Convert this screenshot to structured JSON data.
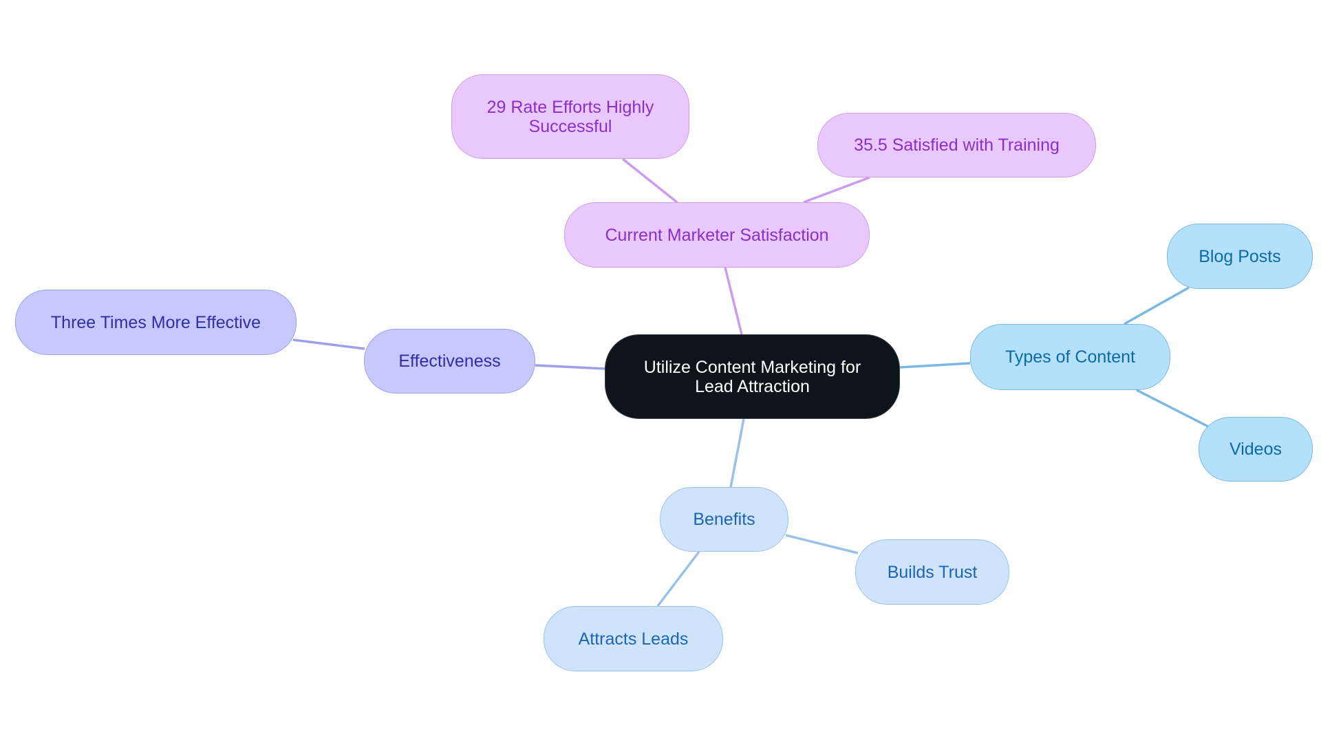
{
  "diagram": {
    "type": "mindmap",
    "root": {
      "id": "root",
      "label": "Utilize Content Marketing for\nLead Attraction",
      "color_scheme": "dark"
    },
    "colors": {
      "root_fill": "#0d141b",
      "root_text": "#ffffff",
      "purple_fill": "#e9c9fd",
      "purple_stroke": "#cd9bee",
      "purple_text": "#8b2fc9",
      "indigo_fill": "#c7c8fd",
      "indigo_stroke": "#9d9fe8",
      "indigo_text": "#2e2fa9",
      "sky_fill": "#b4e0fb",
      "sky_stroke": "#7ab8e4",
      "sky_text": "#0b6ba8",
      "pale_fill": "#cfe4fb",
      "pale_stroke": "#9cc1e9",
      "pale_text": "#1c65b3"
    },
    "branches": [
      {
        "id": "satisfaction",
        "label": "Current Marketer Satisfaction",
        "color_scheme": "purple",
        "children": [
          {
            "id": "highly-successful",
            "label": "29 Rate Efforts Highly\nSuccessful"
          },
          {
            "id": "satisfied-training",
            "label": "35.5 Satisfied with Training"
          }
        ]
      },
      {
        "id": "effectiveness",
        "label": "Effectiveness",
        "color_scheme": "indigo",
        "children": [
          {
            "id": "three-times",
            "label": "Three Times More Effective"
          }
        ]
      },
      {
        "id": "types",
        "label": "Types of Content",
        "color_scheme": "sky",
        "children": [
          {
            "id": "blog-posts",
            "label": "Blog Posts"
          },
          {
            "id": "videos",
            "label": "Videos"
          }
        ]
      },
      {
        "id": "benefits",
        "label": "Benefits",
        "color_scheme": "pale",
        "children": [
          {
            "id": "builds-trust",
            "label": "Builds Trust"
          },
          {
            "id": "attracts-leads",
            "label": "Attracts Leads"
          }
        ]
      }
    ]
  }
}
